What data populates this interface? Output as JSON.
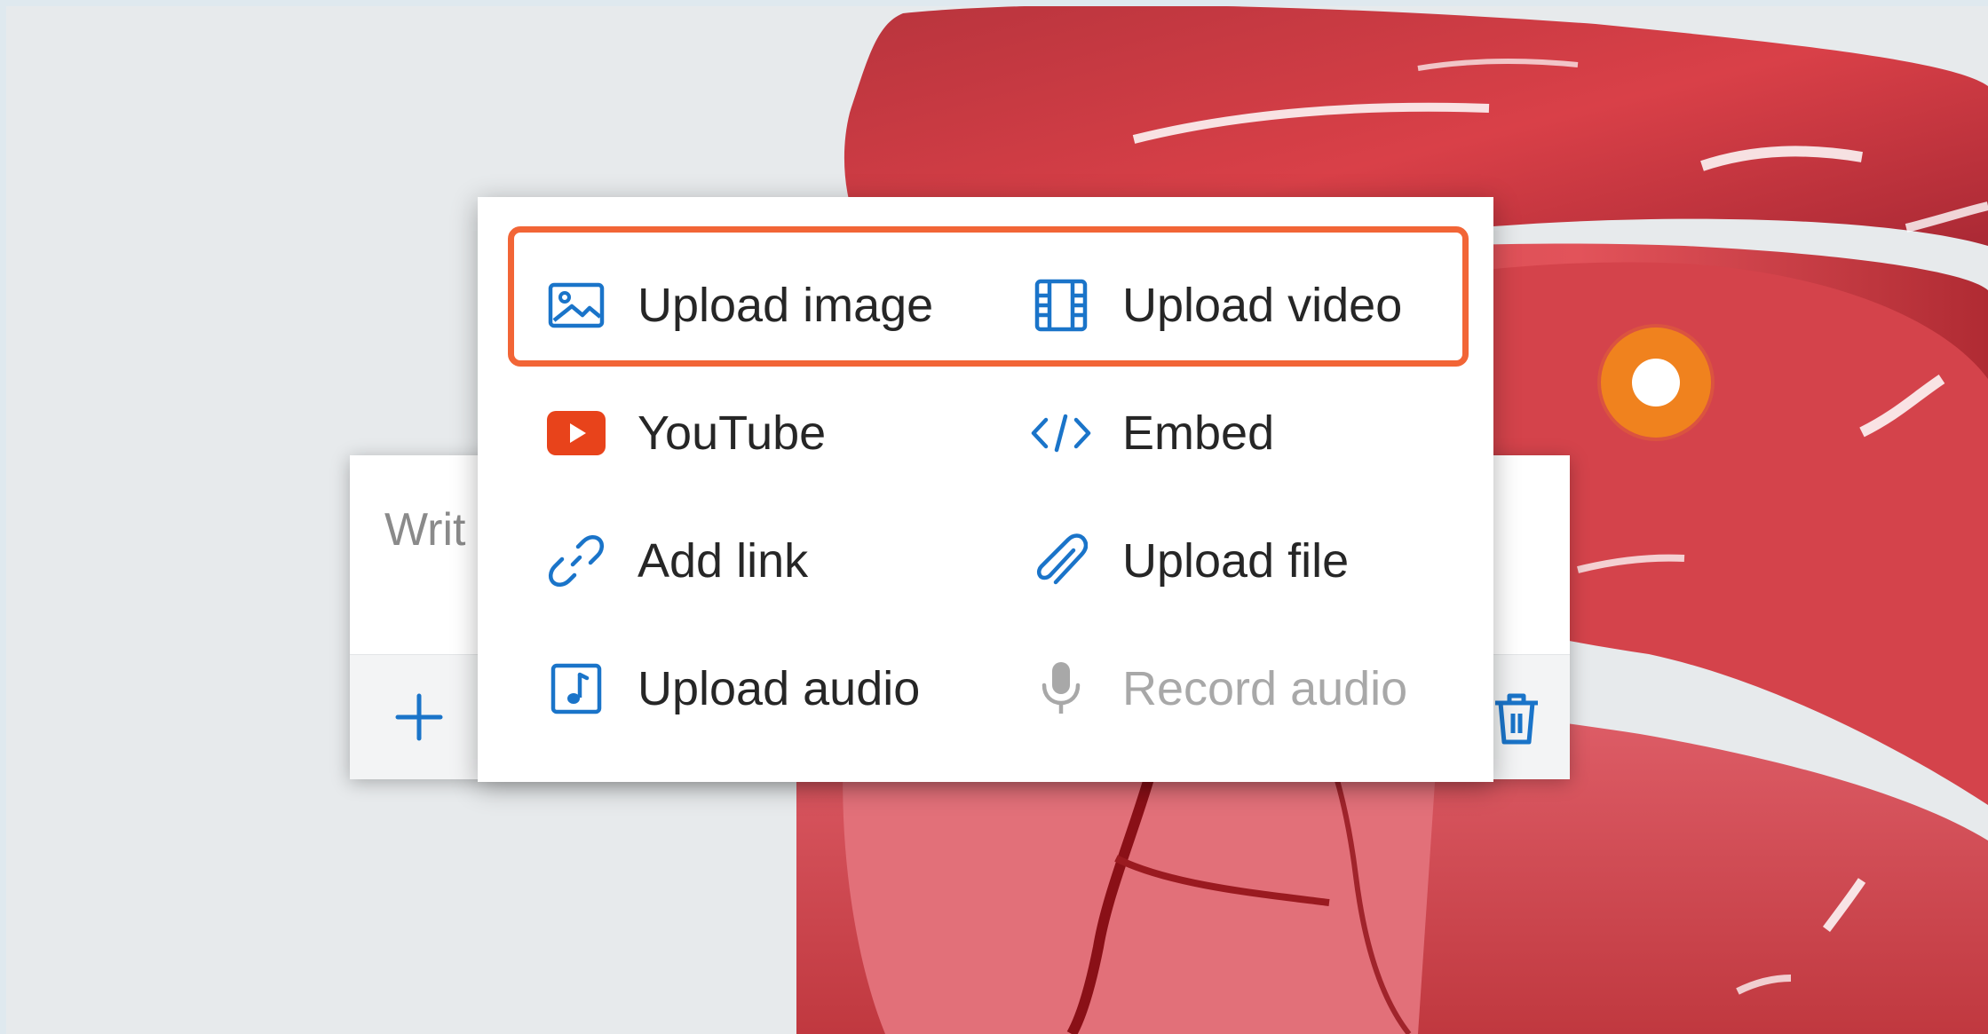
{
  "colors": {
    "accent": "#1a74c9",
    "highlight": "#f26536",
    "youtube": "#e8431b",
    "hotspot": "#f0821e",
    "disabled_text": "#a8a8a8"
  },
  "note": {
    "placeholder": "Writ",
    "add_icon": "plus-icon",
    "delete_icon": "trash-icon"
  },
  "menu": {
    "items": [
      {
        "label": "Upload image",
        "icon": "image-icon",
        "enabled": true
      },
      {
        "label": "Upload video",
        "icon": "film-icon",
        "enabled": true
      },
      {
        "label": "YouTube",
        "icon": "youtube-icon",
        "enabled": true
      },
      {
        "label": "Embed",
        "icon": "code-icon",
        "enabled": true
      },
      {
        "label": "Add link",
        "icon": "link-icon",
        "enabled": true
      },
      {
        "label": "Upload file",
        "icon": "paperclip-icon",
        "enabled": true
      },
      {
        "label": "Upload audio",
        "icon": "music-note-icon",
        "enabled": true
      },
      {
        "label": "Record audio",
        "icon": "microphone-icon",
        "enabled": false
      }
    ]
  }
}
